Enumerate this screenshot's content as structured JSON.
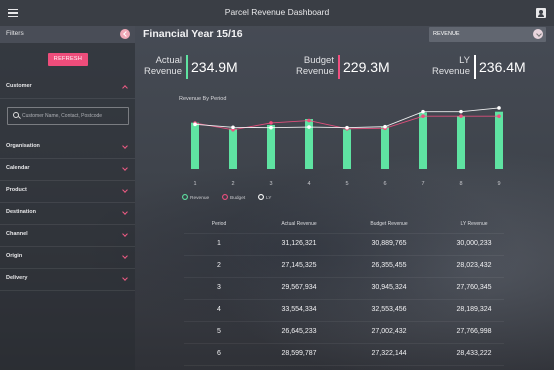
{
  "app": {
    "title": "Parcel Revenue Dashboard"
  },
  "sidebar": {
    "header": "Filters",
    "refresh_label": "REFRESH",
    "customer_label": "Customer",
    "search_placeholder": "Customer Name, Contact, Postcode",
    "sections": [
      {
        "label": "Organisation"
      },
      {
        "label": "Calendar"
      },
      {
        "label": "Product"
      },
      {
        "label": "Destination"
      },
      {
        "label": "Channel"
      },
      {
        "label": "Origin"
      },
      {
        "label": "Delivery"
      }
    ]
  },
  "header": {
    "title": "Financial Year 15/16",
    "select_value": "REVENUE"
  },
  "kpis": [
    {
      "label_line1": "Actual",
      "label_line2": "Revenue",
      "value": "234.9M",
      "color": "#5fe3a2"
    },
    {
      "label_line1": "Budget",
      "label_line2": "Revenue",
      "value": "229.3M",
      "color": "#ef4f7f"
    },
    {
      "label_line1": "LY",
      "label_line2": "Revenue",
      "value": "236.4M",
      "color": "#ffffff"
    }
  ],
  "chart_data": {
    "type": "bar",
    "title": "Revenue By Period",
    "categories": [
      "1",
      "2",
      "3",
      "4",
      "5",
      "6",
      "7",
      "8",
      "9"
    ],
    "series": [
      {
        "name": "Actual",
        "kind": "bar",
        "color": "#5fe3a2",
        "values": [
          31126321,
          27145325,
          29567934,
          33554334,
          26645233,
          28599787,
          38000000,
          35500000,
          38500000
        ]
      },
      {
        "name": "Budget",
        "kind": "line",
        "color": "#ef4f7f",
        "values": [
          30889765,
          26355455,
          30945324,
          32553456,
          27002432,
          27322144,
          35500000,
          35500000,
          35500000
        ]
      },
      {
        "name": "LY",
        "kind": "line",
        "color": "#ffffff",
        "values": [
          30000233,
          28023432,
          27760345,
          28189324,
          27766998,
          28433222,
          38500000,
          38500000,
          41000000
        ]
      }
    ],
    "ylim": [
      0,
      45000000
    ],
    "legend": [
      "Revenue",
      "Budget",
      "LY"
    ]
  },
  "table": {
    "headers": [
      "Period",
      "Actual Revenue",
      "Budget Revenue",
      "LY Revenue"
    ],
    "rows": [
      [
        "1",
        "31,126,321",
        "30,889,765",
        "30,000,233"
      ],
      [
        "2",
        "27,145,325",
        "26,355,455",
        "28,023,432"
      ],
      [
        "3",
        "29,567,934",
        "30,945,324",
        "27,760,345"
      ],
      [
        "4",
        "33,554,334",
        "32,553,456",
        "28,189,324"
      ],
      [
        "5",
        "26,645,233",
        "27,002,432",
        "27,766,998"
      ],
      [
        "6",
        "28,599,787",
        "27,322,144",
        "28,433,222"
      ]
    ]
  },
  "colors": {
    "accent": "#ef4f7f",
    "actual": "#5fe3a2"
  }
}
